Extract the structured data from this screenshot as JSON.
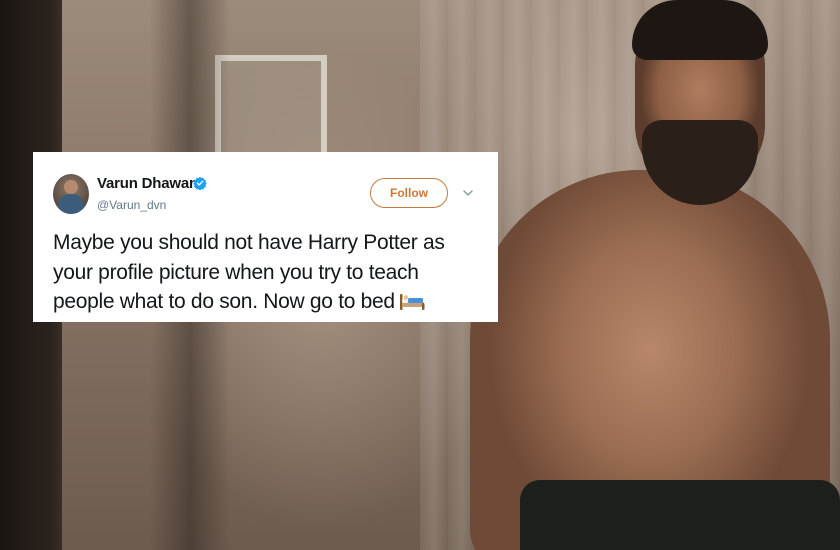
{
  "tweet": {
    "name": "Varun Dhawan",
    "handle": "@Varun_dvn",
    "follow_label": "Follow",
    "text": "Maybe you should not have Harry Potter as your profile picture when you try to teach people what to do son. Now go to bed",
    "emoji_icon": "bed-icon",
    "verified_icon": "verified-badge-icon",
    "menu_icon": "chevron-down-icon"
  },
  "colors": {
    "follow_accent": "#c57a3a",
    "verified_blue": "#1da1f2",
    "name_text": "#14171a",
    "handle_text": "#657786"
  }
}
